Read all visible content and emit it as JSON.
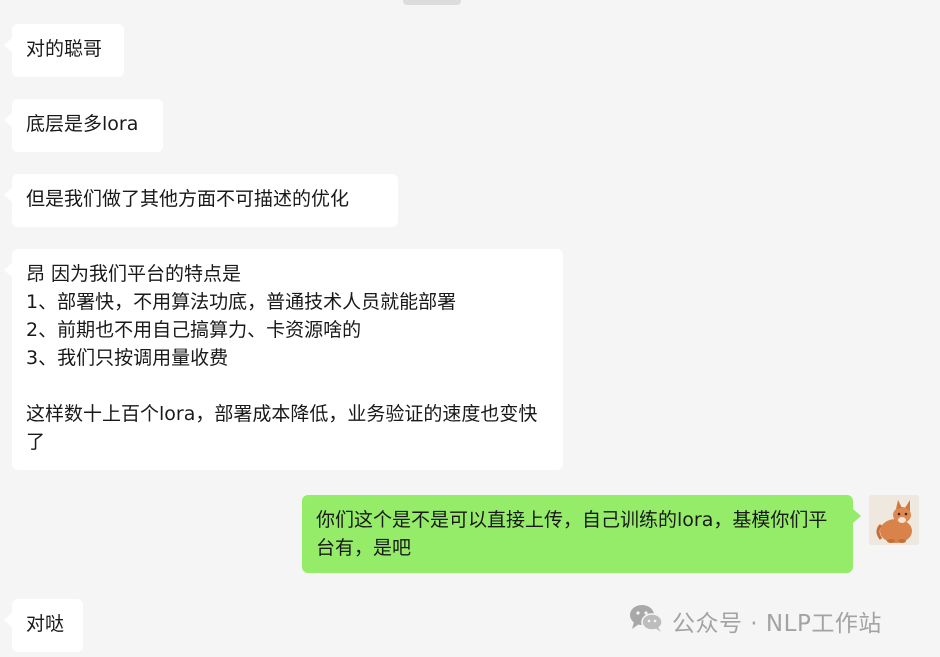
{
  "messages": [
    {
      "id": "m1",
      "direction": "in",
      "text": "对的聪哥"
    },
    {
      "id": "m2",
      "direction": "in",
      "text": "底层是多lora"
    },
    {
      "id": "m3",
      "direction": "in",
      "text": "但是我们做了其他方面不可描述的优化"
    },
    {
      "id": "m4",
      "direction": "in",
      "text": "昂 因为我们平台的特点是\n1、部署快，不用算法功底，普通技术人员就能部署\n2、前期也不用自己搞算力、卡资源啥的\n3、我们只按调用量收费\n\n这样数十上百个lora，部署成本降低，业务验证的速度也变快了"
    },
    {
      "id": "m5",
      "direction": "out",
      "text": "你们这个是不是可以直接上传，自己训练的lora，基模你们平台有，是吧"
    },
    {
      "id": "m6",
      "direction": "in",
      "text": "对哒"
    }
  ],
  "watermark": {
    "text": "公众号 · NLP工作站",
    "icon": "wechat-icon"
  },
  "colors": {
    "background": "#f5f5f5",
    "incoming_bubble": "#ffffff",
    "outgoing_bubble": "#95ec69",
    "text": "#191919",
    "watermark": "#a3a3a3"
  }
}
